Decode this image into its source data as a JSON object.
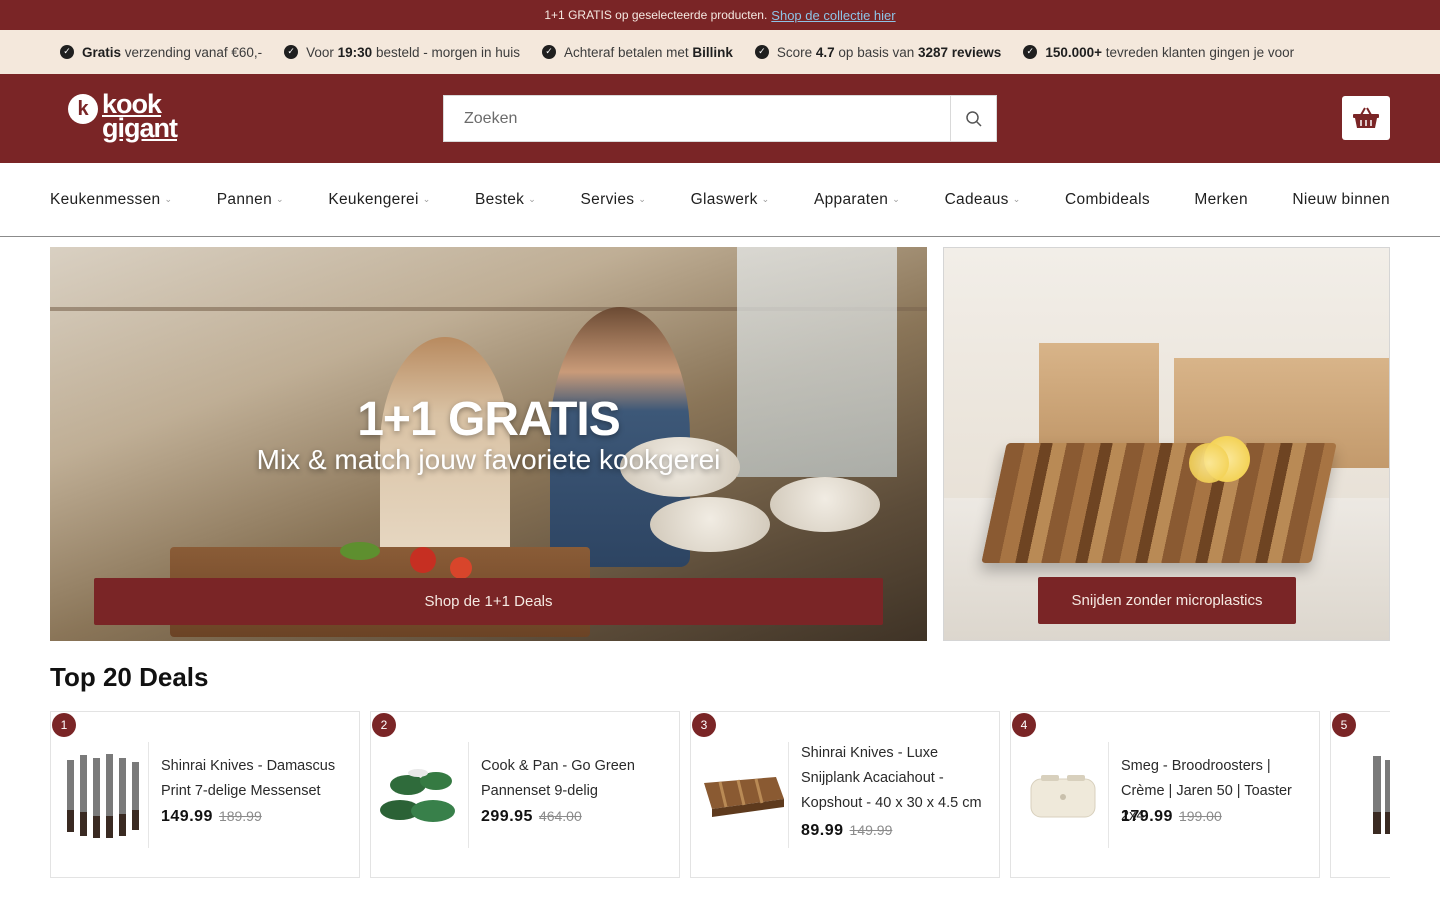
{
  "announcement": {
    "text": "1+1 GRATIS op geselecteerde producten.",
    "link": "Shop de collectie hier"
  },
  "usps": [
    {
      "bold": "Gratis",
      "text": " verzending vanaf €60,-"
    },
    {
      "pre": "Voor ",
      "bold": "19:30",
      "text": " besteld - morgen in huis"
    },
    {
      "pre": "Achteraf betalen met ",
      "bold": "Billink",
      "text": ""
    },
    {
      "pre": "Score ",
      "bold": "4.7",
      "mid": " op basis van ",
      "bold2": "3287 reviews",
      "text": ""
    },
    {
      "bold": "150.000+",
      "text": " tevreden klanten gingen je voor"
    }
  ],
  "header": {
    "logo_line1": "kook",
    "logo_line2": "gigant",
    "search_placeholder": "Zoeken"
  },
  "nav": [
    {
      "label": "Keukenmessen",
      "dropdown": true
    },
    {
      "label": "Pannen",
      "dropdown": true
    },
    {
      "label": "Keukengerei",
      "dropdown": true
    },
    {
      "label": "Bestek",
      "dropdown": true
    },
    {
      "label": "Servies",
      "dropdown": true
    },
    {
      "label": "Glaswerk",
      "dropdown": true
    },
    {
      "label": "Apparaten",
      "dropdown": true
    },
    {
      "label": "Cadeaus",
      "dropdown": true
    },
    {
      "label": "Combideals",
      "dropdown": false
    },
    {
      "label": "Merken",
      "dropdown": false
    },
    {
      "label": "Nieuw binnen",
      "dropdown": false
    }
  ],
  "hero": {
    "title": "1+1 GRATIS",
    "subtitle": "Mix & match jouw favoriete kookgerei",
    "button": "Shop de 1+1 Deals"
  },
  "side_banner": {
    "button": "Snijden zonder microplastics"
  },
  "deals": {
    "title": "Top 20 Deals",
    "items": [
      {
        "rank": "1",
        "name": "Shinrai Knives - Damascus Print 7-delige Messenset",
        "price": "149.99",
        "old_price": "189.99"
      },
      {
        "rank": "2",
        "name": "Cook & Pan - Go Green Pannenset 9-delig",
        "price": "299.95",
        "old_price": "464.00"
      },
      {
        "rank": "3",
        "name": "Shinrai Knives - Luxe Snijplank Acaciahout - Kopshout - 40 x 30 x 4.5 cm",
        "price": "89.99",
        "old_price": "149.99"
      },
      {
        "rank": "4",
        "name": "Smeg - Broodroosters | Crème | Jaren 50 | Toaster 2x4",
        "price": "179.99",
        "old_price": "199.00"
      },
      {
        "rank": "5",
        "name": "",
        "price": "",
        "old_price": ""
      }
    ]
  },
  "colors": {
    "brand": "#7a2526",
    "usp_bg": "#f4e8dc"
  }
}
